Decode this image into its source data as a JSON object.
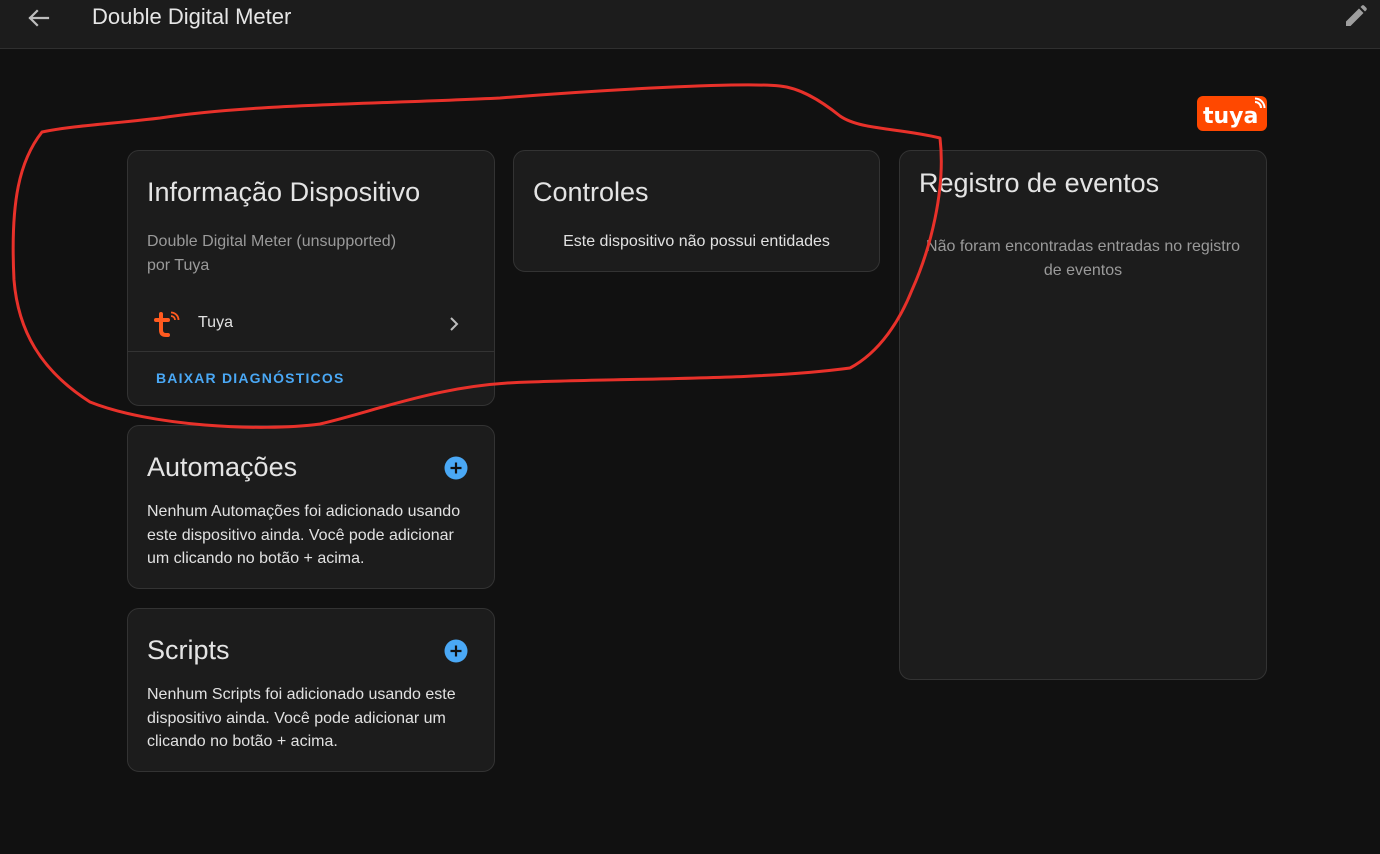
{
  "header": {
    "title": "Double Digital Meter",
    "back_icon": "arrow-left-icon",
    "edit_icon": "pencil-icon"
  },
  "brand": {
    "logo_text": "tuya",
    "accent_color": "#ff4800"
  },
  "device_info": {
    "title": "Informação Dispositivo",
    "model": "Double Digital Meter (unsupported)",
    "manufacturer": "por Tuya",
    "integration_name": "Tuya",
    "integration_icon": "tuya-logo-icon",
    "download_label": "BAIXAR DIAGNÓSTICOS"
  },
  "controls": {
    "title": "Controles",
    "empty_text": "Este dispositivo não possui entidades"
  },
  "events": {
    "title": "Registro de eventos",
    "empty_line1": "Não foram encontradas entradas no registro",
    "empty_line2": "de eventos"
  },
  "automations": {
    "title": "Automações",
    "line1": "Nenhum Automações foi adicionado usando",
    "line2": "este dispositivo ainda. Você pode adicionar",
    "line3": "um clicando no botão + acima."
  },
  "scripts": {
    "title": "Scripts",
    "line1": "Nenhum Scripts foi adicionado usando este",
    "line2": "dispositivo ainda. Você pode adicionar um",
    "line3": "clicando no botão + acima."
  },
  "colors": {
    "background": "#111111",
    "card": "#1c1c1c",
    "primary_blue": "#4aa8f5",
    "annotation_red": "#e8312a"
  }
}
